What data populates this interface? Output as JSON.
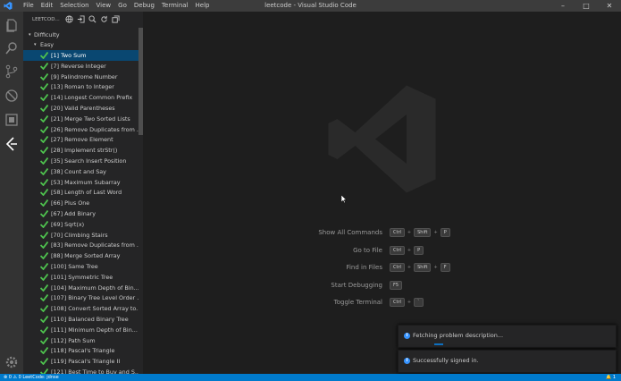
{
  "titlebar": {
    "menu": [
      "File",
      "Edit",
      "Selection",
      "View",
      "Go",
      "Debug",
      "Terminal",
      "Help"
    ],
    "title": "leetcode - Visual Studio Code",
    "controls": [
      "–",
      "□",
      "✕"
    ]
  },
  "sidebar": {
    "header": "LEETCOD...",
    "root": "Difficulty",
    "group": "Easy",
    "problems": [
      "[1] Two Sum",
      "[7] Reverse Integer",
      "[9] Palindrome Number",
      "[13] Roman to Integer",
      "[14] Longest Common Prefix",
      "[20] Valid Parentheses",
      "[21] Merge Two Sorted Lists",
      "[26] Remove Duplicates from ...",
      "[27] Remove Element",
      "[28] Implement strStr()",
      "[35] Search Insert Position",
      "[38] Count and Say",
      "[53] Maximum Subarray",
      "[58] Length of Last Word",
      "[66] Plus One",
      "[67] Add Binary",
      "[69] Sqrt(x)",
      "[70] Climbing Stairs",
      "[83] Remove Duplicates from ...",
      "[88] Merge Sorted Array",
      "[100] Same Tree",
      "[101] Symmetric Tree",
      "[104] Maximum Depth of Bin...",
      "[107] Binary Tree Level Order ...",
      "[108] Convert Sorted Array to...",
      "[110] Balanced Binary Tree",
      "[111] Minimum Depth of Bin...",
      "[112] Path Sum",
      "[118] Pascal's Triangle",
      "[119] Pascal's Triangle II",
      "[121] Best Time to Buy and S..."
    ]
  },
  "editor": {
    "commands": [
      {
        "name": "Show All Commands",
        "keys": [
          "Ctrl",
          "Shift",
          "P"
        ]
      },
      {
        "name": "Go to File",
        "keys": [
          "Ctrl",
          "P"
        ]
      },
      {
        "name": "Find in Files",
        "keys": [
          "Ctrl",
          "Shift",
          "F"
        ]
      },
      {
        "name": "Start Debugging",
        "keys": [
          "F5"
        ]
      },
      {
        "name": "Toggle Terminal",
        "keys": [
          "Ctrl",
          "`"
        ]
      }
    ]
  },
  "notifications": [
    {
      "text": "Fetching problem description..."
    },
    {
      "text": "Successfully signed in."
    }
  ],
  "statusbar": {
    "left": "⊗ 0  ⚠ 0     LeetCode: jdnse",
    "right": "🔔 1"
  },
  "colors": {
    "accent": "#007acc",
    "selection": "#094771",
    "check": "#4ec14e"
  }
}
